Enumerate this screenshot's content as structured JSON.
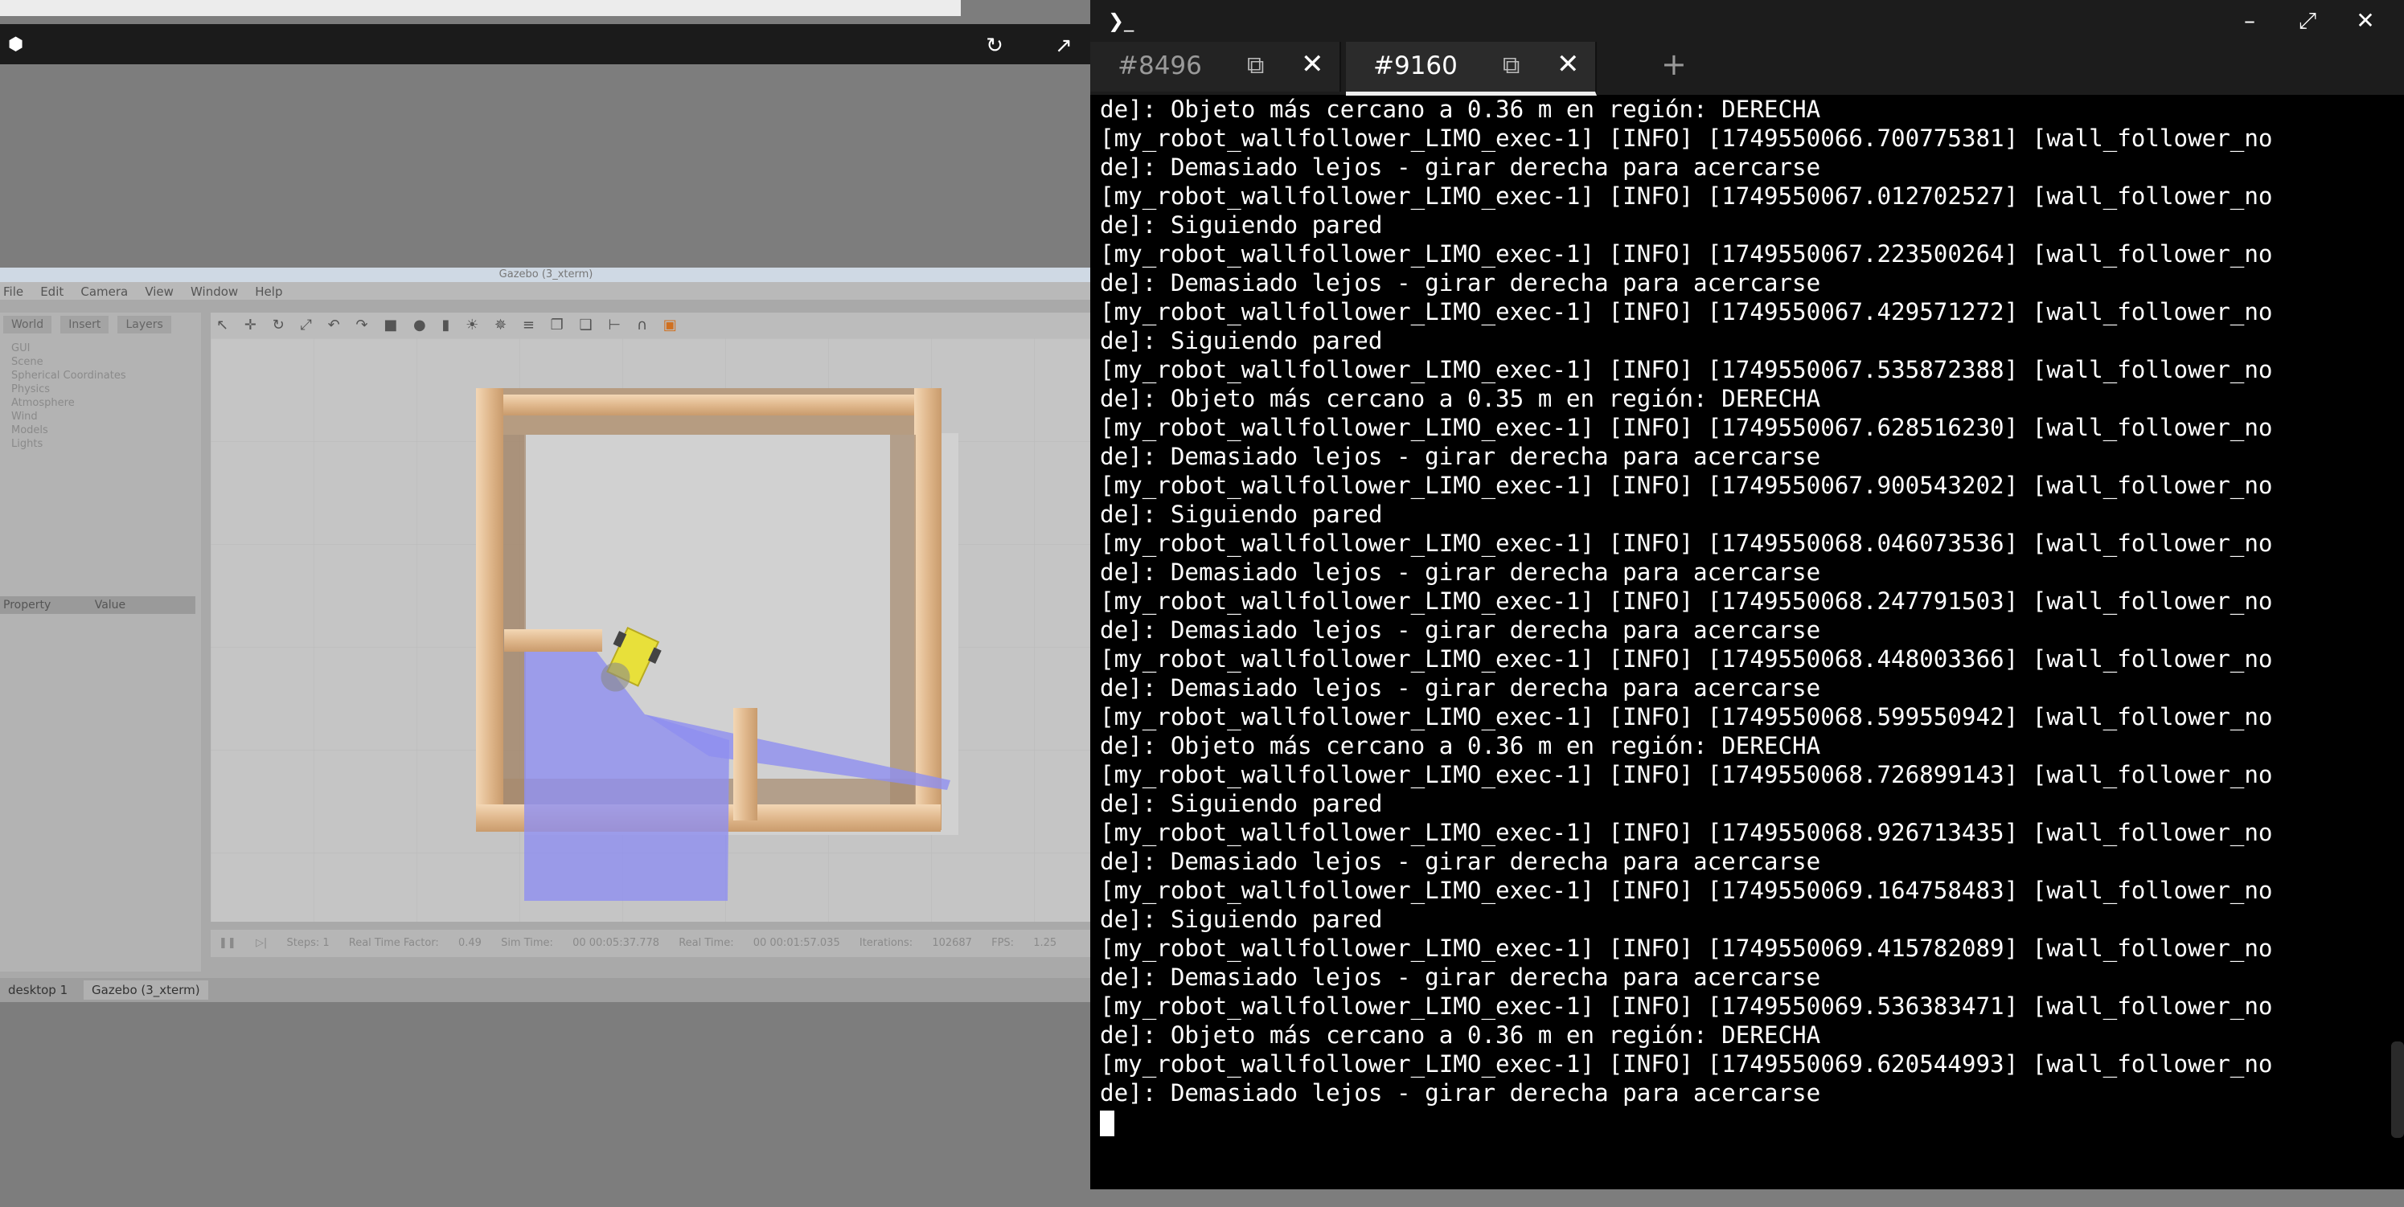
{
  "gazebo": {
    "title": "Gazebo (3_xterm)",
    "menu": [
      "File",
      "Edit",
      "Camera",
      "View",
      "Window",
      "Help"
    ],
    "tabs": [
      "World",
      "Insert",
      "Layers"
    ],
    "tree": [
      "GUI",
      "Scene",
      "Spherical Coordinates",
      "Physics",
      "Atmosphere",
      "Wind",
      "Models",
      "Lights"
    ],
    "prop_headers": [
      "Property",
      "Value"
    ],
    "bottom": {
      "steps_label": "Steps: 1",
      "rtf_label": "Real Time Factor:",
      "rtf_value": "0.49",
      "sim_label": "Sim Time:",
      "sim_value": "00 00:05:37.778",
      "real_label": "Real Time:",
      "real_value": "00 00:01:57.035",
      "iter_label": "Iterations:",
      "iter_value": "102687",
      "fps_label": "FPS:",
      "fps_value": "1.25"
    }
  },
  "taskbar": {
    "desktop": "desktop 1",
    "app": "Gazebo (3_xterm)"
  },
  "terminal": {
    "tabs": [
      {
        "label": "#8496"
      },
      {
        "label": "#9160"
      }
    ],
    "lines": [
      "de]: Objeto más cercano a 0.36 m en región: DERECHA",
      "[my_robot_wallfollower_LIMO_exec-1] [INFO] [1749550066.700775381] [wall_follower_no",
      "de]: Demasiado lejos - girar derecha para acercarse",
      "[my_robot_wallfollower_LIMO_exec-1] [INFO] [1749550067.012702527] [wall_follower_no",
      "de]: Siguiendo pared",
      "[my_robot_wallfollower_LIMO_exec-1] [INFO] [1749550067.223500264] [wall_follower_no",
      "de]: Demasiado lejos - girar derecha para acercarse",
      "[my_robot_wallfollower_LIMO_exec-1] [INFO] [1749550067.429571272] [wall_follower_no",
      "de]: Siguiendo pared",
      "[my_robot_wallfollower_LIMO_exec-1] [INFO] [1749550067.535872388] [wall_follower_no",
      "de]: Objeto más cercano a 0.35 m en región: DERECHA",
      "[my_robot_wallfollower_LIMO_exec-1] [INFO] [1749550067.628516230] [wall_follower_no",
      "de]: Demasiado lejos - girar derecha para acercarse",
      "[my_robot_wallfollower_LIMO_exec-1] [INFO] [1749550067.900543202] [wall_follower_no",
      "de]: Siguiendo pared",
      "[my_robot_wallfollower_LIMO_exec-1] [INFO] [1749550068.046073536] [wall_follower_no",
      "de]: Demasiado lejos - girar derecha para acercarse",
      "[my_robot_wallfollower_LIMO_exec-1] [INFO] [1749550068.247791503] [wall_follower_no",
      "de]: Demasiado lejos - girar derecha para acercarse",
      "[my_robot_wallfollower_LIMO_exec-1] [INFO] [1749550068.448003366] [wall_follower_no",
      "de]: Demasiado lejos - girar derecha para acercarse",
      "[my_robot_wallfollower_LIMO_exec-1] [INFO] [1749550068.599550942] [wall_follower_no",
      "de]: Objeto más cercano a 0.36 m en región: DERECHA",
      "[my_robot_wallfollower_LIMO_exec-1] [INFO] [1749550068.726899143] [wall_follower_no",
      "de]: Siguiendo pared",
      "[my_robot_wallfollower_LIMO_exec-1] [INFO] [1749550068.926713435] [wall_follower_no",
      "de]: Demasiado lejos - girar derecha para acercarse",
      "[my_robot_wallfollower_LIMO_exec-1] [INFO] [1749550069.164758483] [wall_follower_no",
      "de]: Siguiendo pared",
      "[my_robot_wallfollower_LIMO_exec-1] [INFO] [1749550069.415782089] [wall_follower_no",
      "de]: Demasiado lejos - girar derecha para acercarse",
      "[my_robot_wallfollower_LIMO_exec-1] [INFO] [1749550069.536383471] [wall_follower_no",
      "de]: Objeto más cercano a 0.36 m en región: DERECHA",
      "[my_robot_wallfollower_LIMO_exec-1] [INFO] [1749550069.620544993] [wall_follower_no",
      "de]: Demasiado lejos - girar derecha para acercarse"
    ]
  },
  "colors": {
    "terminal_bg": "#000000",
    "terminal_fg": "#ffffff",
    "wall_wood": "#e2b98c",
    "laser_blue": "#8f8ff0",
    "robot_yellow": "#e8e03a"
  }
}
